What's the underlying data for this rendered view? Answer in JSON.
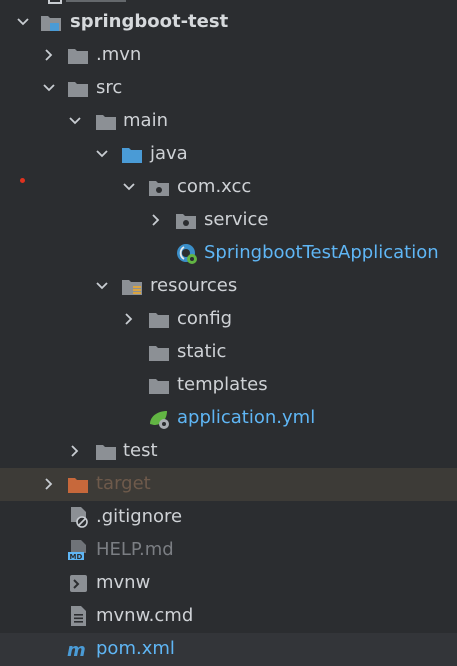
{
  "project": {
    "root_label": "springboot-test"
  },
  "tree": {
    "mvn": ".mvn",
    "src": "src",
    "main": "main",
    "java": "java",
    "package": "com.xcc",
    "service": "service",
    "app_class": "SpringbootTestApplication",
    "resources": "resources",
    "config": "config",
    "static": "static",
    "templates": "templates",
    "app_yml": "application.yml",
    "test": "test",
    "target": "target",
    "gitignore": ".gitignore",
    "help": "HELP.md",
    "mvnw": "mvnw",
    "mvnw_cmd": "mvnw.cmd",
    "pom": "pom.xml"
  },
  "icons": {
    "project_module": "module-folder-icon",
    "folder": "folder-icon",
    "source_root": "source-root-folder-icon",
    "package": "package-icon",
    "resources_root": "resources-root-folder-icon",
    "spring_boot_class": "spring-boot-class-icon",
    "spring_yaml": "spring-config-file-icon",
    "excluded_folder": "excluded-folder-icon",
    "ignore_file": "ignore-file-icon",
    "markdown": "markdown-file-icon",
    "shell_script": "shell-script-icon",
    "text_file": "text-file-icon",
    "maven": "maven-icon"
  },
  "colors": {
    "background": "#2b2d30",
    "text": "#cfd2d6",
    "link_blue": "#5fb6f5",
    "excluded_orange": "#c7683b",
    "target_row_highlight": "#3d3b37",
    "dim_text": "#7b7e83",
    "folder_gray": "#8c9095",
    "source_blue": "#4a9bd6",
    "spring_green": "#62b543"
  }
}
